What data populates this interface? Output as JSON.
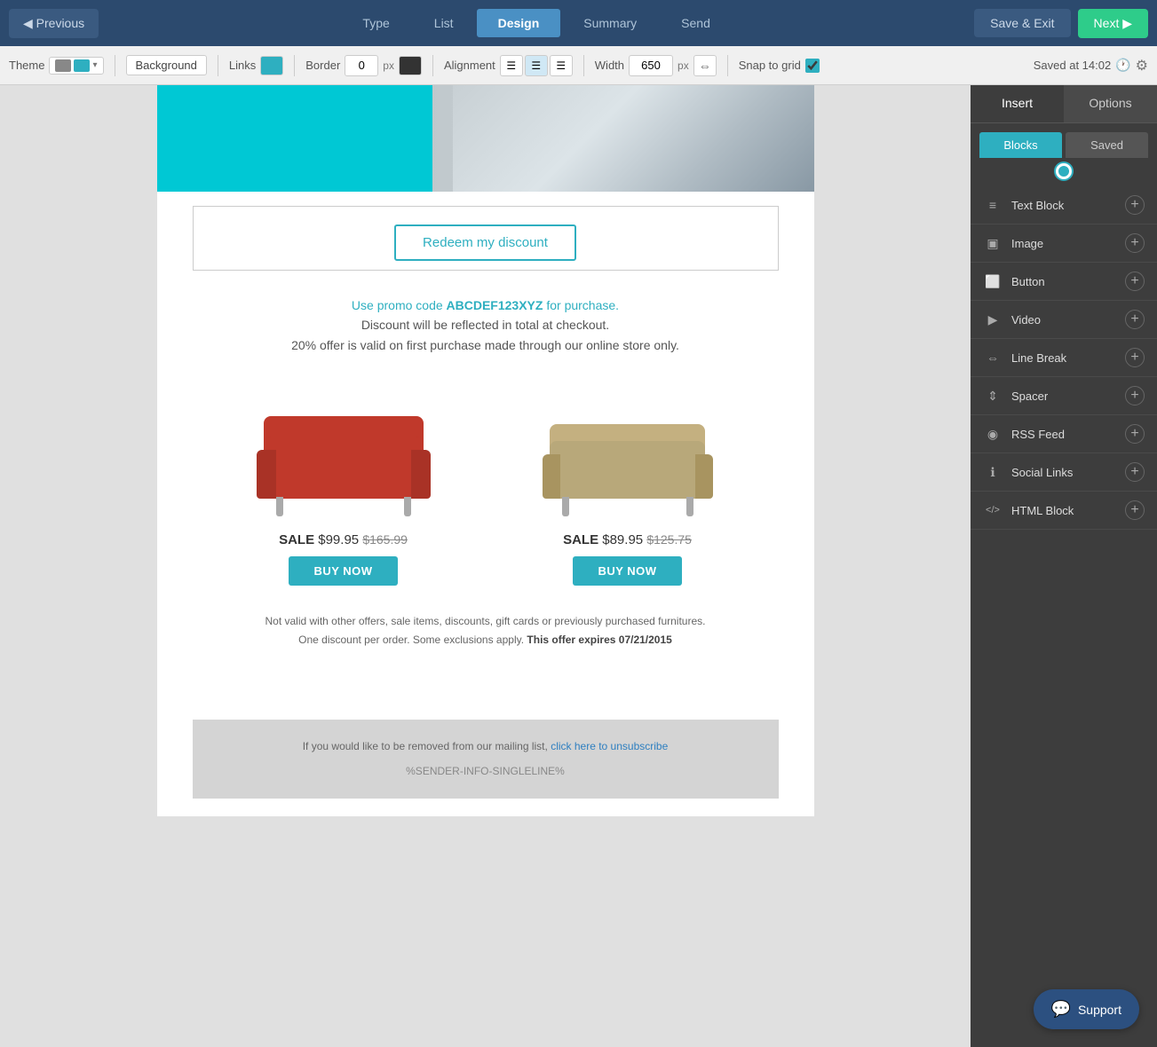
{
  "topnav": {
    "prev_label": "◀ Previous",
    "steps": [
      {
        "id": "type",
        "label": "Type",
        "active": false
      },
      {
        "id": "list",
        "label": "List",
        "active": false
      },
      {
        "id": "design",
        "label": "Design",
        "active": true
      },
      {
        "id": "summary",
        "label": "Summary",
        "active": false
      },
      {
        "id": "send",
        "label": "Send",
        "active": false
      }
    ],
    "save_exit_label": "Save & Exit",
    "next_label": "Next ▶"
  },
  "toolbar": {
    "theme_label": "Theme",
    "bg_label": "Background",
    "links_label": "Links",
    "border_label": "Border",
    "border_value": "0",
    "px_label": "px",
    "alignment_label": "Alignment",
    "width_label": "Width",
    "width_value": "650",
    "snap_label": "Snap to grid",
    "saved_text": "Saved at 14:02"
  },
  "canvas": {
    "redeem_btn_label": "Redeem my discount",
    "promo_text_intro": "Use promo code ",
    "promo_code": "ABCDEF123XYZ",
    "promo_text_for": " for purchase.",
    "promo_line1": "Discount will be reflected in total at checkout.",
    "promo_line2": "20% offer is valid on first purchase made through our online store only.",
    "product1": {
      "sale_label": "SALE",
      "price": "$99.95",
      "old_price": "$165.99",
      "btn_label": "BUY NOW"
    },
    "product2": {
      "sale_label": "SALE",
      "price": "$89.95",
      "old_price": "$125.75",
      "btn_label": "BUY NOW"
    },
    "disclaimer_line1": "Not valid with other offers, sale items, discounts, gift cards or previously purchased furnitures.",
    "disclaimer_line2": "One discount per order. Some exclusions apply.",
    "disclaimer_expires": "This offer expires 07/21/2015",
    "footer_text": "If you would like to be removed from our mailing list,",
    "footer_link": "click here to unsubscribe",
    "footer_code": "%SENDER-INFO-SINGLELINE%"
  },
  "right_panel": {
    "tab_insert": "Insert",
    "tab_options": "Options",
    "subtab_blocks": "Blocks",
    "subtab_saved": "Saved",
    "blocks": [
      {
        "id": "text-block",
        "label": "Text Block",
        "icon": "≡"
      },
      {
        "id": "image",
        "label": "Image",
        "icon": "▣"
      },
      {
        "id": "button",
        "label": "Button",
        "icon": "⬜"
      },
      {
        "id": "video",
        "label": "Video",
        "icon": "▶"
      },
      {
        "id": "line-break",
        "label": "Line Break",
        "icon": "⇔"
      },
      {
        "id": "spacer",
        "label": "Spacer",
        "icon": "⇕"
      },
      {
        "id": "rss-feed",
        "label": "RSS Feed",
        "icon": "◉"
      },
      {
        "id": "social-links",
        "label": "Social Links",
        "icon": "ℹ"
      },
      {
        "id": "html-block",
        "label": "HTML Block",
        "icon": "</>"
      }
    ]
  },
  "support": {
    "label": "Support",
    "icon": "💬"
  }
}
